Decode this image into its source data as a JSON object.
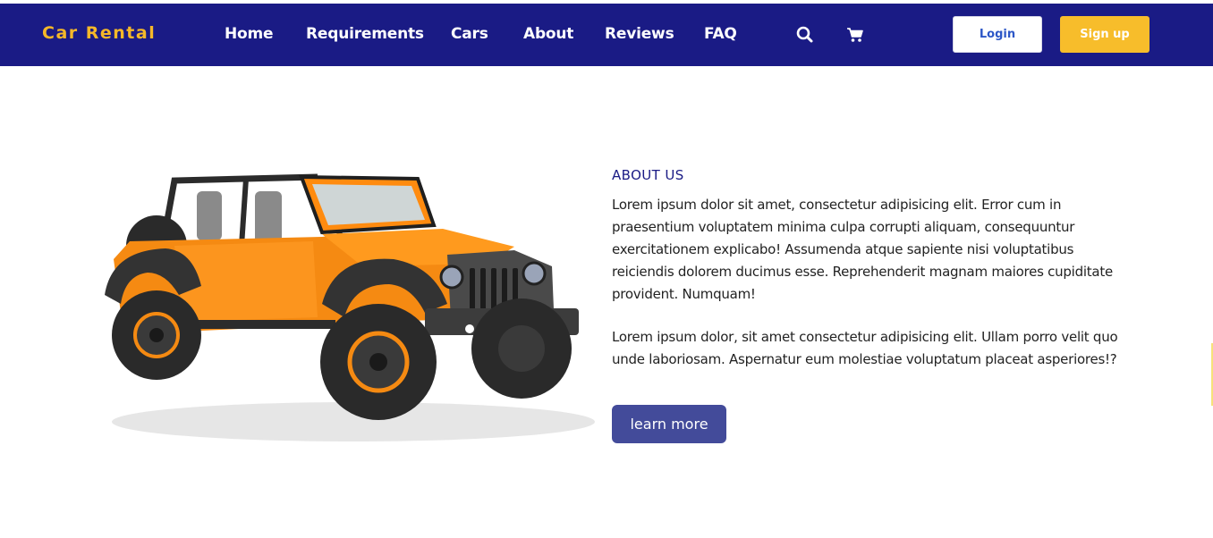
{
  "brand": {
    "name": "Car Rental",
    "color": "#f5b829"
  },
  "nav": {
    "background": "#1a1b85",
    "links": [
      "Home",
      "Requirements",
      "Cars",
      "About",
      "Reviews",
      "FAQ"
    ],
    "icons": [
      "search-icon",
      "cart-icon"
    ],
    "login_label": "Login",
    "signup_label": "Sign up"
  },
  "about": {
    "title": "ABOUT US",
    "paragraph1": "Lorem ipsum dolor sit amet, consectetur adipisicing elit. Error cum in praesentium voluptatem minima culpa corrupti aliquam, consequuntur exercitationem explicabo! Assumenda atque sapiente nisi voluptatibus reiciendis dolorem ducimus esse. Reprehenderit magnam maiores cupiditate provident. Numquam!",
    "paragraph2": "Lorem ipsum dolor, sit amet consectetur adipisicing elit. Ullam porro velit quo unde laboriosam. Aspernatur eum molestiae voluptatum placeat asperiores!?",
    "button_label": "learn more"
  },
  "colors": {
    "accent": "#f7bd2b",
    "button": "#434b9a",
    "car_body": "#f58a12"
  }
}
